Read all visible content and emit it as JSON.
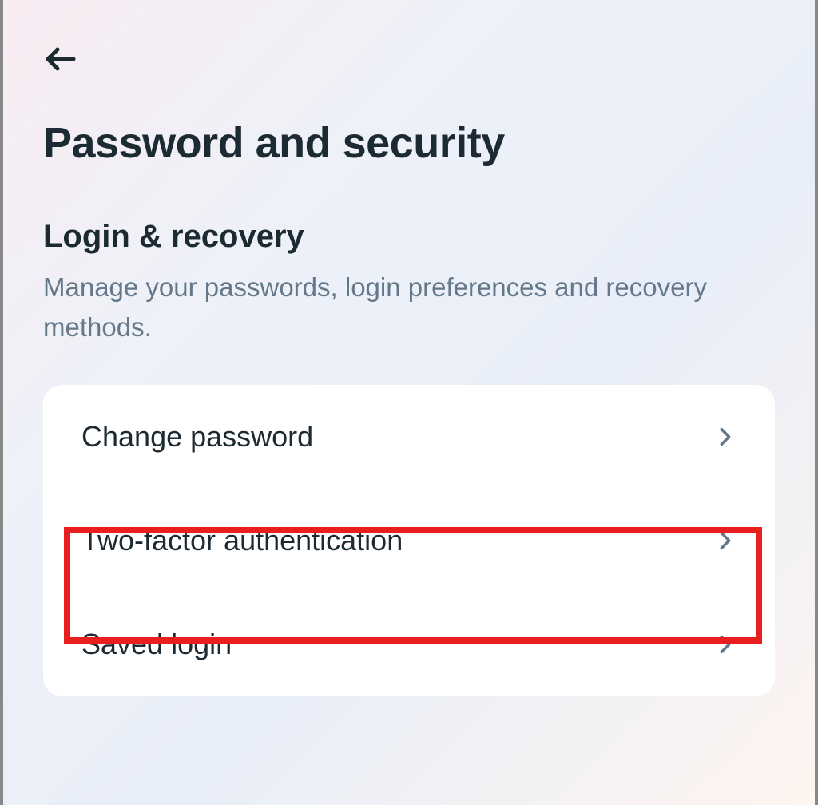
{
  "page": {
    "title": "Password and security"
  },
  "section": {
    "title": "Login & recovery",
    "description": "Manage your passwords, login preferences and recovery methods."
  },
  "menu": {
    "items": [
      {
        "label": "Change password"
      },
      {
        "label": "Two-factor authentication"
      },
      {
        "label": "Saved login"
      }
    ]
  }
}
